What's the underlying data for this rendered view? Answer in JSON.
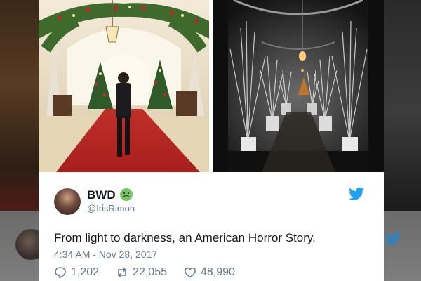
{
  "tweet": {
    "display_name": "BWD",
    "handle": "@IrisRimon",
    "text": "From light to darkness, an American Horror Story.",
    "timestamp": "4:34 AM - Nov 28, 2017",
    "counts": {
      "replies": "1,202",
      "retweets": "22,055",
      "likes": "48,990"
    }
  },
  "icons": {
    "emoji": "nauseated-face-emoji",
    "brand": "twitter-bird-icon"
  },
  "colors": {
    "twitter_blue": "#1da1f2",
    "text": "#14171a",
    "muted": "#657786"
  }
}
